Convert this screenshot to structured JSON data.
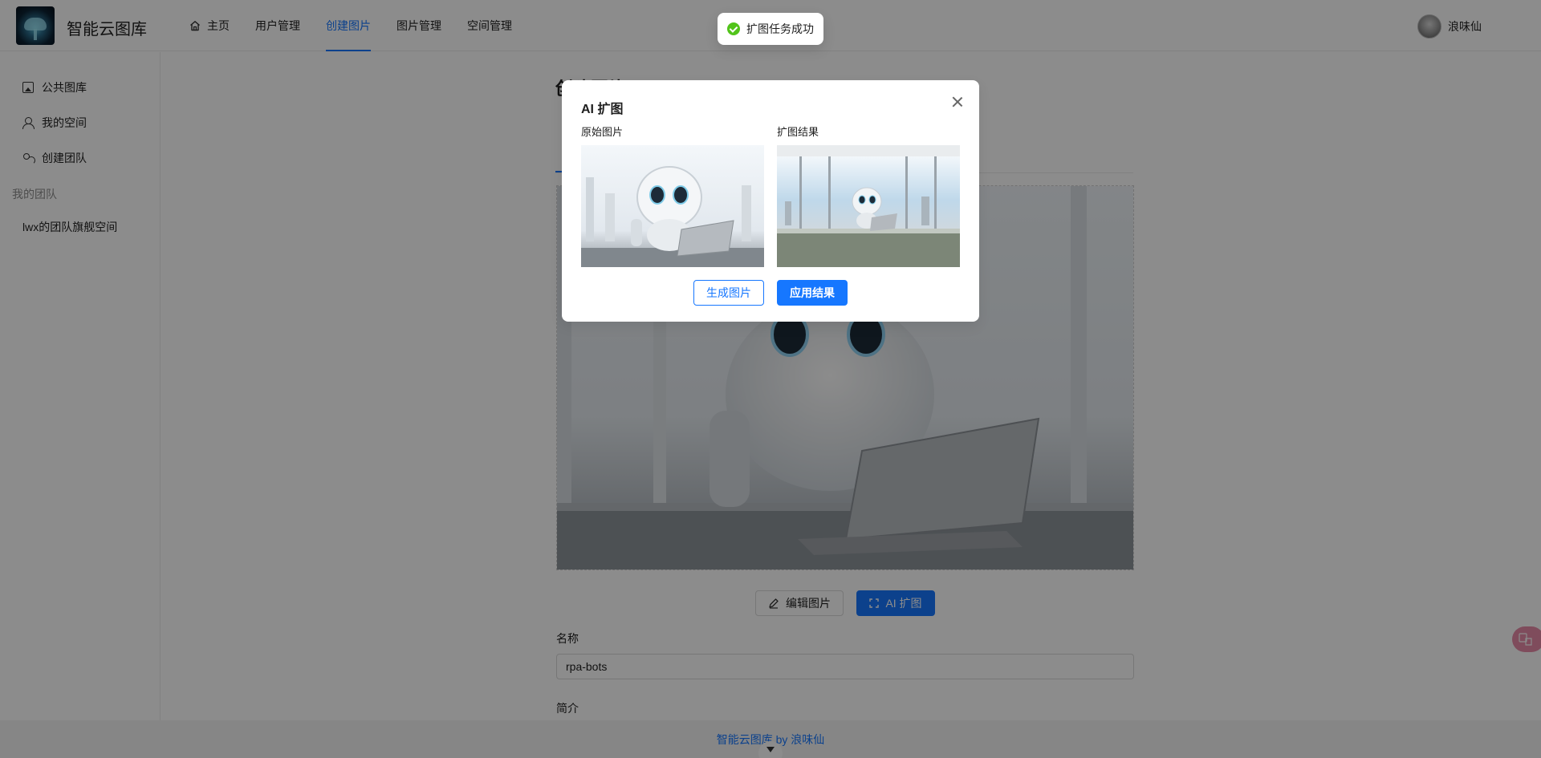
{
  "header": {
    "site_title": "智能云图库",
    "nav": [
      {
        "label": "主页",
        "icon": "home-icon"
      },
      {
        "label": "用户管理"
      },
      {
        "label": "创建图片",
        "active": true
      },
      {
        "label": "图片管理"
      },
      {
        "label": "空间管理"
      }
    ],
    "user_name": "浪味仙"
  },
  "sidebar": {
    "items": [
      {
        "label": "公共图库",
        "icon": "picture-icon"
      },
      {
        "label": "我的空间",
        "icon": "user-icon"
      },
      {
        "label": "创建团队",
        "icon": "team-icon"
      }
    ],
    "group_label": "我的团队",
    "team_items": [
      {
        "label": "lwx的团队旗舰空间"
      }
    ]
  },
  "main": {
    "page_title": "创建图片",
    "edit_button": "编辑图片",
    "ai_button": "AI 扩图",
    "name_label": "名称",
    "name_value": "rpa-bots",
    "intro_label": "简介"
  },
  "footer": {
    "text": "智能云图库 by 浪味仙"
  },
  "toast": {
    "message": "扩图任务成功"
  },
  "modal": {
    "title": "AI 扩图",
    "original_label": "原始图片",
    "result_label": "扩图结果",
    "generate_button": "生成图片",
    "apply_button": "应用结果"
  },
  "colors": {
    "primary": "#1677ff",
    "success": "#52c41a",
    "overlay": "rgba(0,0,0,0.45)"
  }
}
